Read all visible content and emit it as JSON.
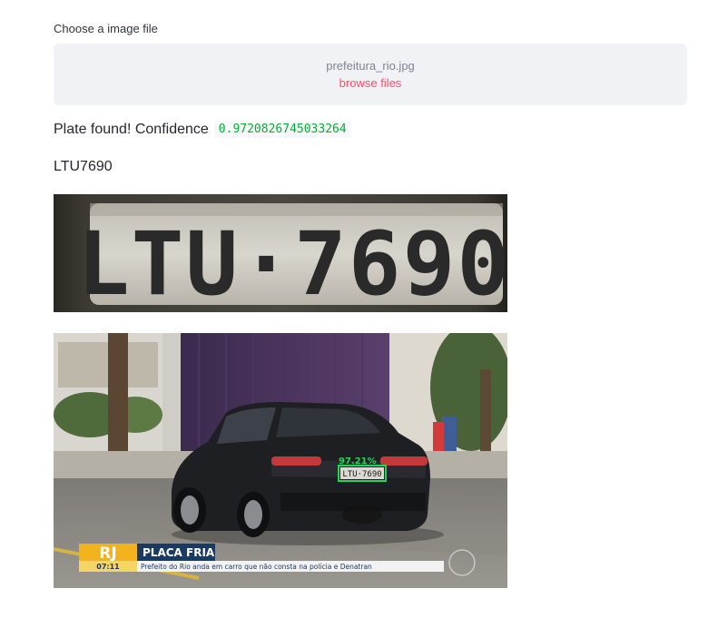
{
  "uploader": {
    "label": "Choose a image file",
    "file_name": "prefeitura_rio.jpg",
    "browse_label": "browse files"
  },
  "result": {
    "message": "Plate found! Confidence",
    "confidence": "0.9720826745033264",
    "plate_text": "LTU7690"
  },
  "plate_image": {
    "characters": "LTU·7690"
  },
  "scene_image": {
    "detection_label": "97.21%",
    "detection_plate": "LTU·7690",
    "news_logo": "RJ",
    "news_time": "07:11",
    "news_headline": "PLACA FRIA",
    "news_ticker": "Prefeito do Rio anda em carro que não consta na polícia e Denatran",
    "colors": {
      "box": "#1fd655",
      "headline_bg": "#1b3a63",
      "accent": "#f2b21b"
    }
  }
}
